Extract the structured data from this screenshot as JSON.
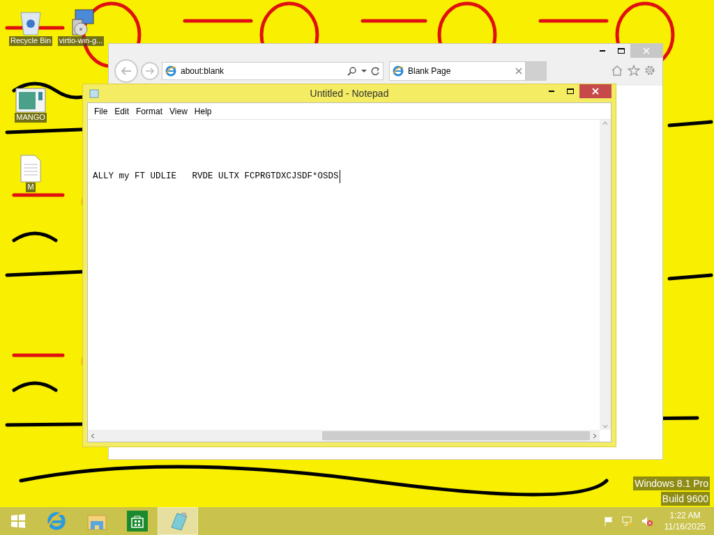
{
  "desktop_icons": [
    {
      "kind": "recycle",
      "label": "Recycle Bin"
    },
    {
      "kind": "installer",
      "label": "virtio-win-g..."
    },
    {
      "kind": "app",
      "label": "MANGO"
    },
    {
      "kind": "document",
      "label": "M"
    }
  ],
  "browser": {
    "address": "about:blank",
    "tabs": [
      {
        "label": "Blank Page",
        "selected": true
      }
    ]
  },
  "notepad": {
    "title": "Untitled - Notepad",
    "menu": [
      "File",
      "Edit",
      "Format",
      "View",
      "Help"
    ],
    "text": "ALLY my FT UDLIE   RVDE ULTX FCPRGTDXCJSDF*OSDS"
  },
  "edition": [
    "Windows 8.1 Pro",
    "Build 9600"
  ],
  "taskbar": {
    "apps": [
      {
        "kind": "start",
        "selected": false
      },
      {
        "kind": "ie",
        "selected": false
      },
      {
        "kind": "explorer",
        "selected": false
      },
      {
        "kind": "store",
        "selected": false
      },
      {
        "kind": "notepad",
        "selected": true
      }
    ],
    "time": "1:22 AM",
    "date": "11/16/2025"
  }
}
